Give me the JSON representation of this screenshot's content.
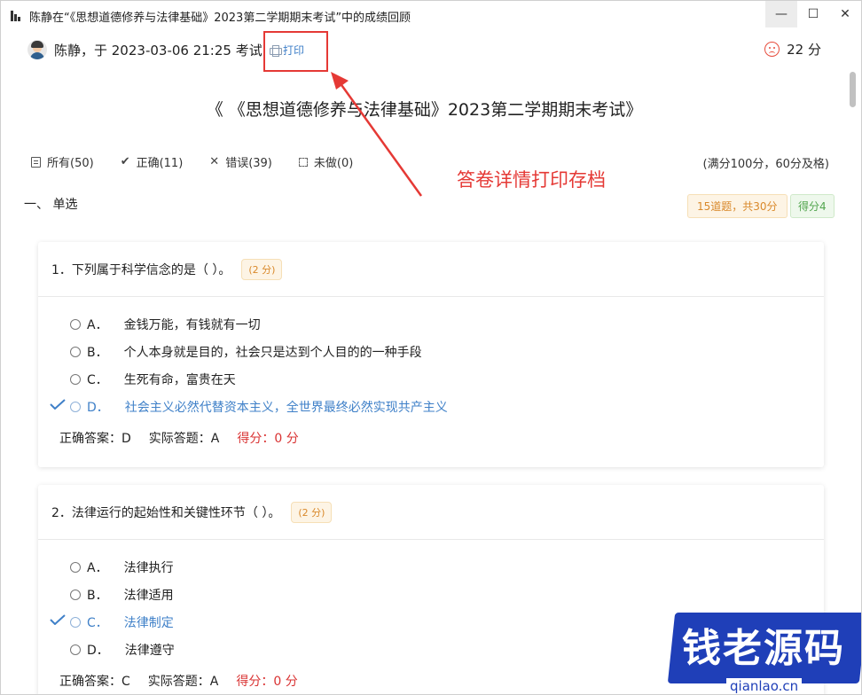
{
  "window": {
    "title": "陈静在“《思想道德修养与法律基础》2023第二学期期末考试”中的成绩回顾",
    "controls": {
      "minimize": "—",
      "maximize": "☐",
      "close": "✕"
    }
  },
  "header": {
    "user_line": "陈静，于 2023-03-06 21:25 考试",
    "print_label": "打印",
    "score": "22 分"
  },
  "exam_title": "《 《思想道德修养与法律基础》2023第二学期期末考试》",
  "filters": [
    {
      "icon": "doc-icon",
      "label": "所有(50)"
    },
    {
      "icon": "check-icon",
      "label": "正确(11)"
    },
    {
      "icon": "cross-icon",
      "label": "错误(39)"
    },
    {
      "icon": "box-icon",
      "label": "未做(0)"
    }
  ],
  "full_score": "(满分100分，60分及格)",
  "annotation": "答卷详情打印存档",
  "section": {
    "title": "一、 单选",
    "count_tag": "15道题，共30分",
    "score_tag": "得分4"
  },
  "questions": [
    {
      "title": "1．下列属于科学信念的是（ ）。",
      "score": "(2 分)",
      "options": [
        {
          "letter": "A．",
          "text": "金钱万能，有钱就有一切"
        },
        {
          "letter": "B．",
          "text": "个人本身就是目的，社会只是达到个人目的的一种手段"
        },
        {
          "letter": "C．",
          "text": "生死有命，富贵在天"
        },
        {
          "letter": "D．",
          "text": "社会主义必然代替资本主义，全世界最终必然实现共产主义"
        }
      ],
      "correct_answer": "正确答案：D",
      "actual_answer": "实际答题：A",
      "got_score": "得分：0 分"
    },
    {
      "title": "2．法律运行的起始性和关键性环节（ ）。",
      "score": "(2 分)",
      "options": [
        {
          "letter": "A．",
          "text": "法律执行"
        },
        {
          "letter": "B．",
          "text": "法律适用"
        },
        {
          "letter": "C．",
          "text": "法律制定"
        },
        {
          "letter": "D．",
          "text": "法律遵守"
        }
      ],
      "correct_answer": "正确答案：C",
      "actual_answer": "实际答题：A",
      "got_score": "得分：0 分"
    }
  ],
  "watermark": {
    "text": "钱老源码",
    "url": "qianlao.cn"
  },
  "colors": {
    "accent_blue": "#3f80c8",
    "red": "#e53935",
    "orange_tag": "#d9892b",
    "green_tag": "#52a54e",
    "watermark_blue": "#1f3fb8"
  }
}
